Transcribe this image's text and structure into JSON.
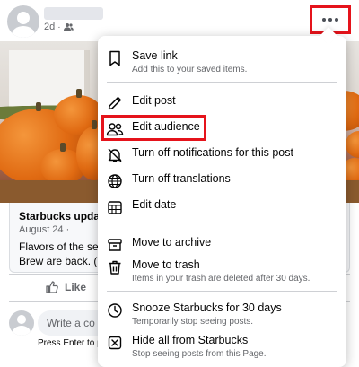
{
  "post": {
    "meta_time": "2d",
    "meta_separator": "·",
    "link_title": "Starbucks update",
    "link_date": "August 24 ·",
    "link_text_line1": "Flavors of the seas",
    "link_text_line2": "Brew are back. (U",
    "like_label": "Like",
    "comment_placeholder": "Write a co",
    "press_enter": "Press Enter to p"
  },
  "menu": {
    "items": [
      {
        "label": "Save link",
        "sub": "Add this to your saved items.",
        "icon": "bookmark-icon"
      },
      {
        "label": "Edit post",
        "icon": "pencil-icon"
      },
      {
        "label": "Edit audience",
        "icon": "people-icon"
      },
      {
        "label": "Turn off notifications for this post",
        "icon": "bell-off-icon"
      },
      {
        "label": "Turn off translations",
        "icon": "globe-icon"
      },
      {
        "label": "Edit date",
        "icon": "calendar-icon"
      },
      {
        "label": "Move to archive",
        "icon": "archive-icon"
      },
      {
        "label": "Move to trash",
        "sub": "Items in your trash are deleted after 30 days.",
        "icon": "trash-icon"
      },
      {
        "label": "Snooze Starbucks for 30 days",
        "sub": "Temporarily stop seeing posts.",
        "icon": "clock-icon"
      },
      {
        "label": "Hide all from Starbucks",
        "sub": "Stop seeing posts from this Page.",
        "icon": "hide-icon"
      }
    ]
  },
  "colors": {
    "highlight": "#e5131b",
    "text_primary": "#050505",
    "text_secondary": "#65676b"
  }
}
